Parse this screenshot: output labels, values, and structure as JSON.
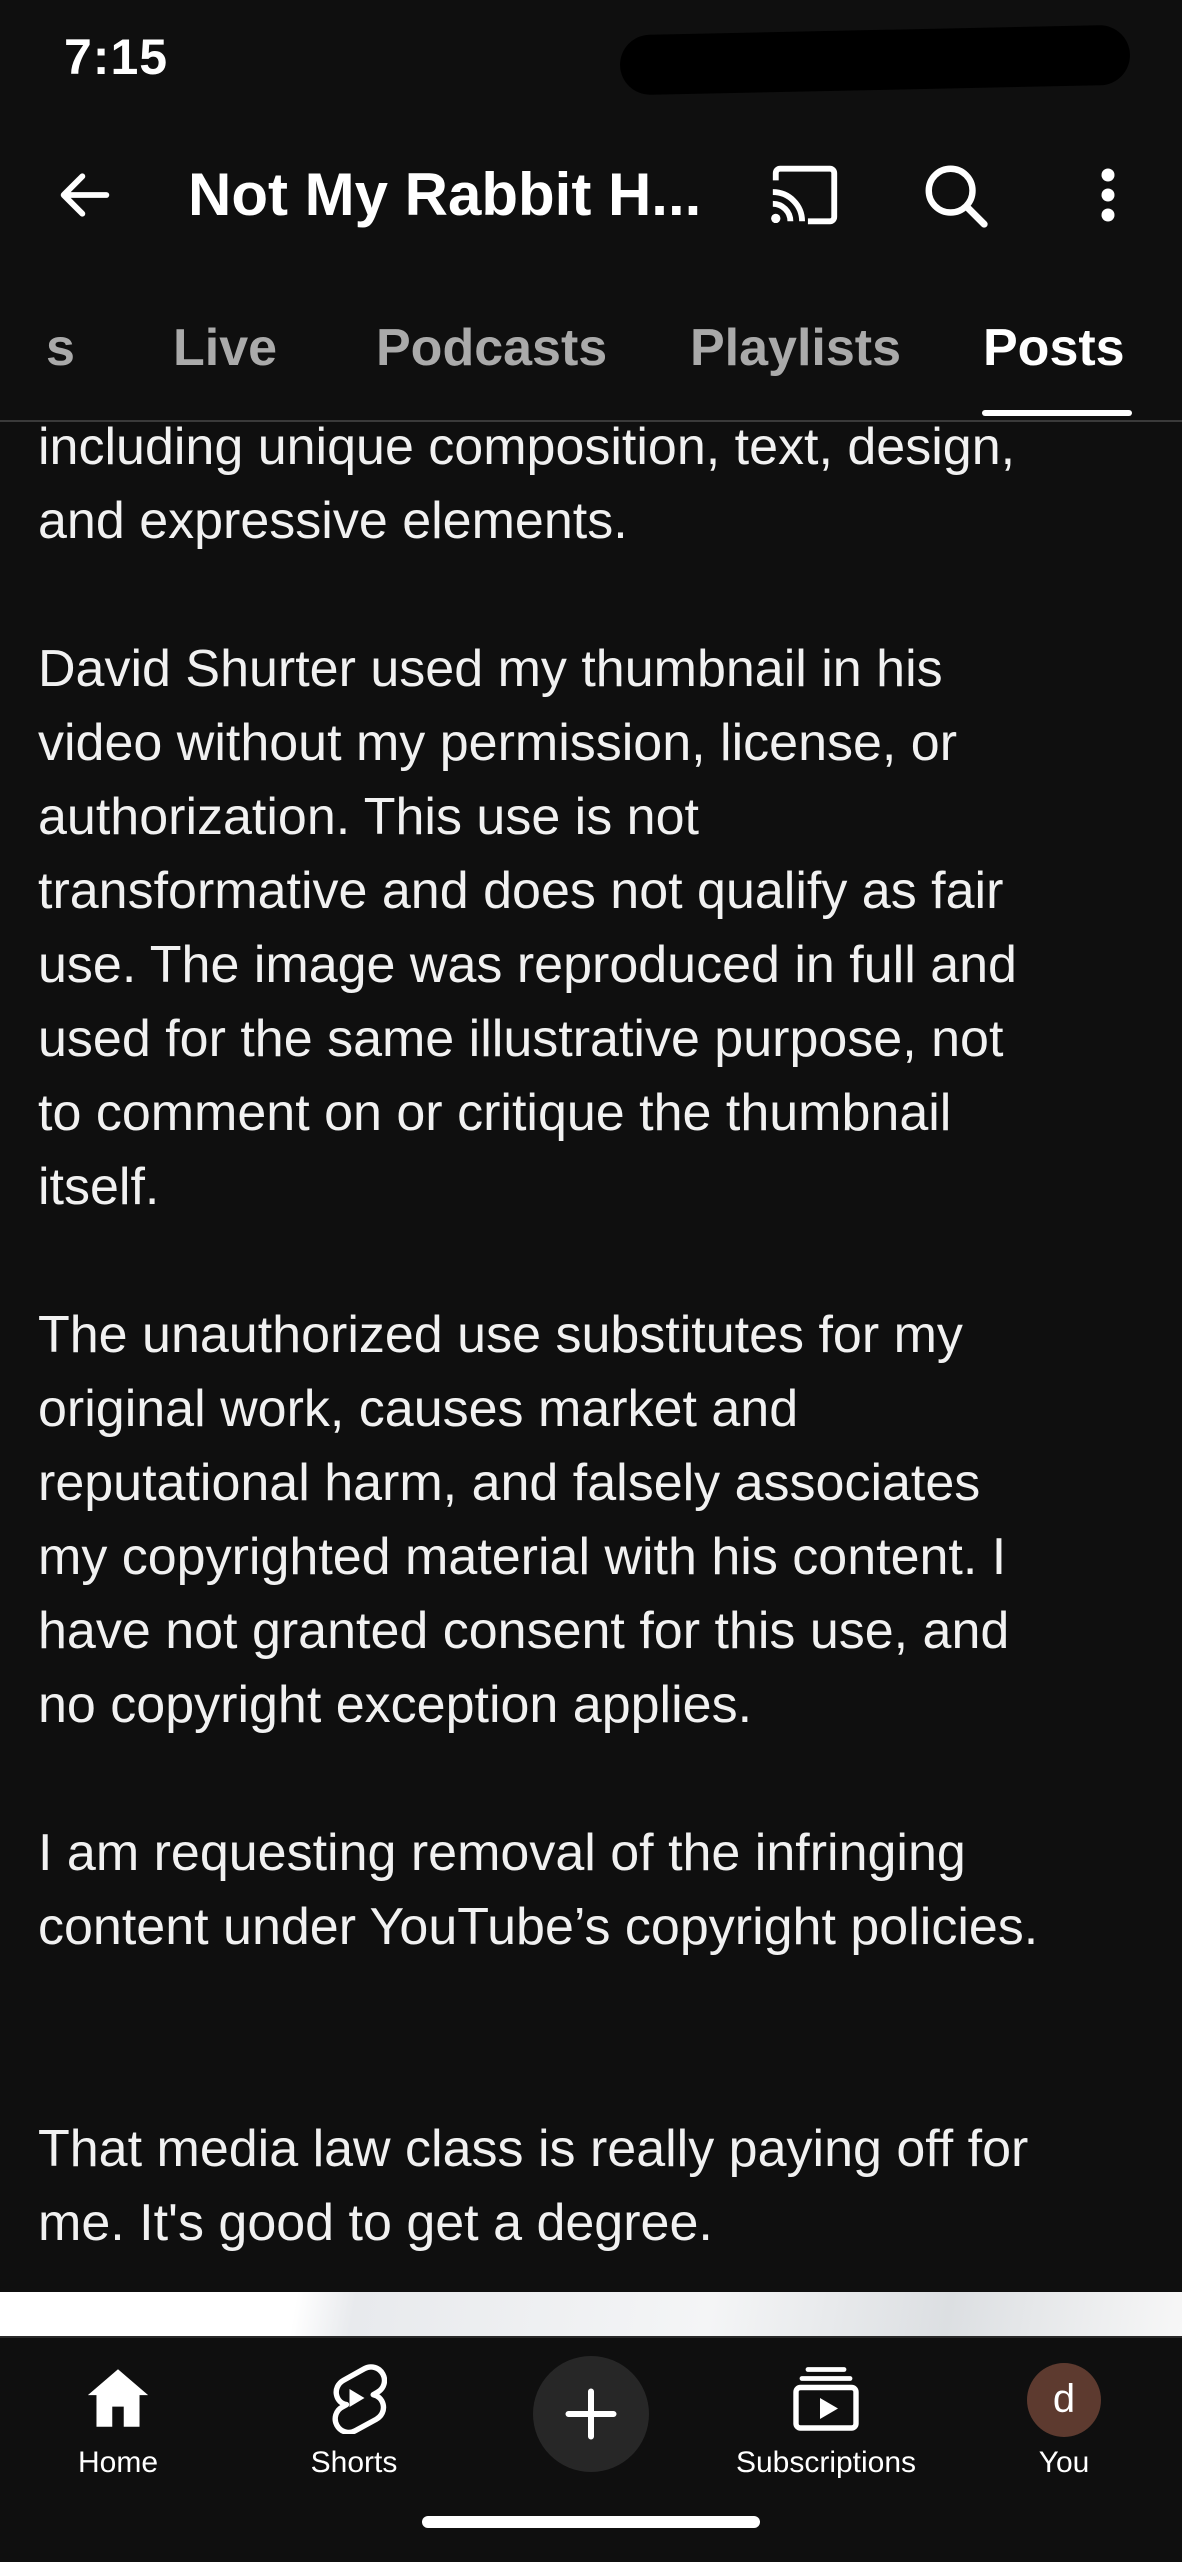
{
  "status_bar": {
    "time": "7:15"
  },
  "header": {
    "title": "Not My Rabbit H...",
    "icons": [
      "back-arrow-icon",
      "cast-icon",
      "search-icon",
      "more-vert-icon"
    ]
  },
  "tabs": [
    {
      "label": "s",
      "active": false
    },
    {
      "label": "Live",
      "active": false
    },
    {
      "label": "Podcasts",
      "active": false
    },
    {
      "label": "Playlists",
      "active": false
    },
    {
      "label": "Posts",
      "active": true
    }
  ],
  "post": {
    "paragraphs": [
      "including unique composition, text, design,\nand expressive elements.",
      "David Shurter used my thumbnail in his\nvideo without my permission, license, or\nauthorization. This use is not\ntransformative and does not qualify as fair\nuse. The image was reproduced in full and\nused for the same illustrative purpose, not\nto comment on or critique the thumbnail\nitself.",
      "The unauthorized use substitutes for my\noriginal work, causes market and\nreputational harm, and falsely associates\nmy copyrighted material with his content. I\nhave not granted consent for this use, and\nno copyright exception applies.",
      "I am requesting removal of the infringing\ncontent under YouTube’s copyright policies.",
      "That media law class is really paying off for\nme. It's good to get a degree."
    ]
  },
  "bottom_nav": {
    "home": "Home",
    "shorts": "Shorts",
    "create_icon": "plus-icon",
    "subscriptions": "Subscriptions",
    "you": "You",
    "avatar_letter": "d",
    "avatar_color": "#5d3a2f"
  },
  "colors": {
    "background": "#0f0f0f",
    "text": "#f1f1f1",
    "inactive_tab": "#aaaaaa"
  }
}
